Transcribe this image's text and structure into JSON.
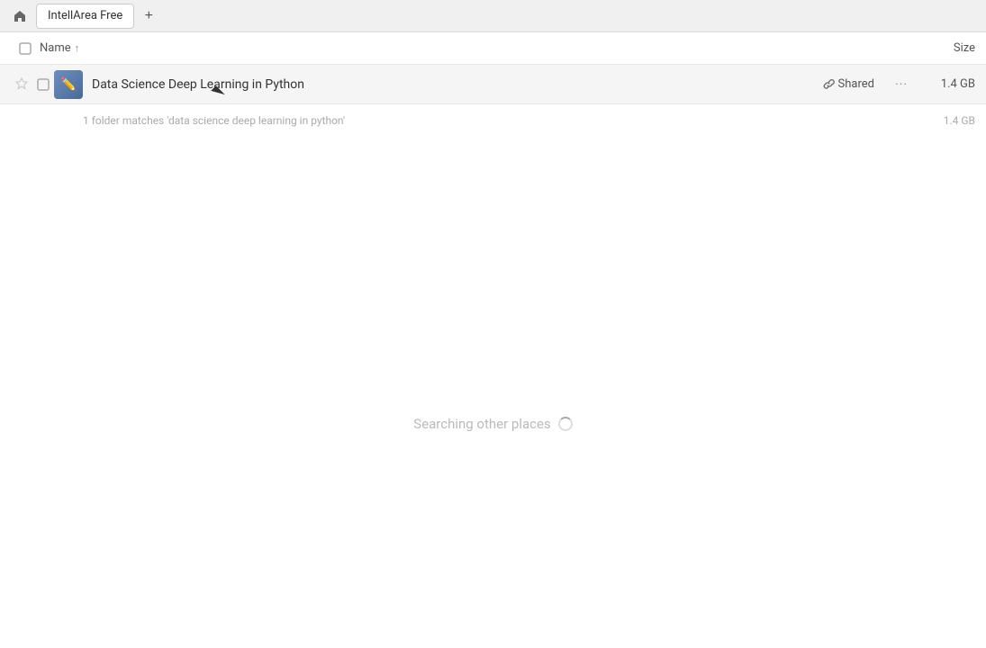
{
  "tabBar": {
    "homeIcon": "🏠",
    "tabLabel": "IntellArea Free",
    "addTabLabel": "+"
  },
  "columnHeaders": {
    "nameLabel": "Name",
    "sortIndicator": "↑",
    "sizeLabel": "Size"
  },
  "fileRow": {
    "fileName": "Data Science Deep Learning in Python",
    "sharedLabel": "Shared",
    "fileSize": "1.4 GB",
    "moreIcon": "···"
  },
  "summaryRow": {
    "text": "1 folder matches 'data science deep learning in python'",
    "size": "1.4 GB"
  },
  "searchingArea": {
    "text": "Searching other places"
  }
}
